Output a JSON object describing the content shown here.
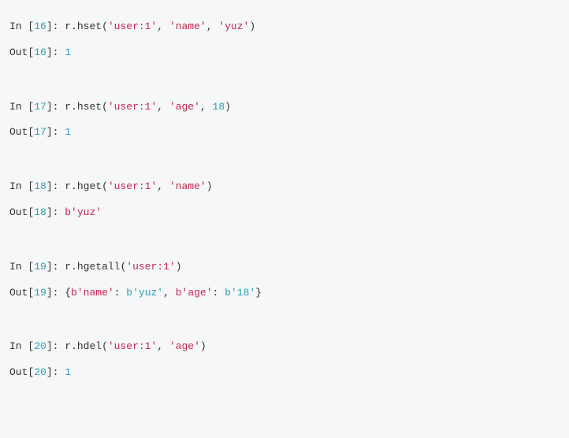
{
  "cells": [
    {
      "in_num": "16",
      "in_tokens": [
        {
          "t": "r",
          "c": "code"
        },
        {
          "t": ".",
          "c": "punct"
        },
        {
          "t": "hset(",
          "c": "code"
        },
        {
          "t": "'user:1'",
          "c": "str"
        },
        {
          "t": ", ",
          "c": "punct"
        },
        {
          "t": "'name'",
          "c": "str"
        },
        {
          "t": ", ",
          "c": "punct"
        },
        {
          "t": "'yuz'",
          "c": "str"
        },
        {
          "t": ")",
          "c": "code"
        }
      ],
      "out_num": "16",
      "out_tokens": [
        {
          "t": "1",
          "c": "int"
        }
      ]
    },
    {
      "in_num": "17",
      "in_tokens": [
        {
          "t": "r",
          "c": "code"
        },
        {
          "t": ".",
          "c": "punct"
        },
        {
          "t": "hset(",
          "c": "code"
        },
        {
          "t": "'user:1'",
          "c": "str"
        },
        {
          "t": ", ",
          "c": "punct"
        },
        {
          "t": "'age'",
          "c": "str"
        },
        {
          "t": ", ",
          "c": "punct"
        },
        {
          "t": "18",
          "c": "int"
        },
        {
          "t": ")",
          "c": "code"
        }
      ],
      "out_num": "17",
      "out_tokens": [
        {
          "t": "1",
          "c": "int"
        }
      ]
    },
    {
      "in_num": "18",
      "in_tokens": [
        {
          "t": "r",
          "c": "code"
        },
        {
          "t": ".",
          "c": "punct"
        },
        {
          "t": "hget(",
          "c": "code"
        },
        {
          "t": "'user:1'",
          "c": "str"
        },
        {
          "t": ", ",
          "c": "punct"
        },
        {
          "t": "'name'",
          "c": "str"
        },
        {
          "t": ")",
          "c": "code"
        }
      ],
      "out_num": "18",
      "out_tokens": [
        {
          "t": "b",
          "c": "bytes"
        },
        {
          "t": "'yuz'",
          "c": "bytes"
        }
      ]
    },
    {
      "in_num": "19",
      "in_tokens": [
        {
          "t": "r",
          "c": "code"
        },
        {
          "t": ".",
          "c": "punct"
        },
        {
          "t": "hgetall(",
          "c": "code"
        },
        {
          "t": "'user:1'",
          "c": "str"
        },
        {
          "t": ")",
          "c": "code"
        }
      ],
      "out_num": "19",
      "out_tokens": [
        {
          "t": "{",
          "c": "punct"
        },
        {
          "t": "b",
          "c": "bytes"
        },
        {
          "t": "'name'",
          "c": "bytes"
        },
        {
          "t": ": ",
          "c": "punct"
        },
        {
          "t": "b",
          "c": "bytes-val"
        },
        {
          "t": "'yuz'",
          "c": "bytes-val"
        },
        {
          "t": ", ",
          "c": "punct"
        },
        {
          "t": "b",
          "c": "bytes"
        },
        {
          "t": "'age'",
          "c": "bytes"
        },
        {
          "t": ": ",
          "c": "punct"
        },
        {
          "t": "b",
          "c": "bytes-val"
        },
        {
          "t": "'18'",
          "c": "bytes-val"
        },
        {
          "t": "}",
          "c": "punct"
        }
      ]
    },
    {
      "in_num": "20",
      "in_tokens": [
        {
          "t": "r",
          "c": "code"
        },
        {
          "t": ".",
          "c": "punct"
        },
        {
          "t": "hdel(",
          "c": "code"
        },
        {
          "t": "'user:1'",
          "c": "str"
        },
        {
          "t": ", ",
          "c": "punct"
        },
        {
          "t": "'age'",
          "c": "str"
        },
        {
          "t": ")",
          "c": "code"
        }
      ],
      "out_num": "20",
      "out_tokens": [
        {
          "t": "1",
          "c": "int"
        }
      ]
    }
  ],
  "labels": {
    "in_prefix": "In [",
    "in_suffix": "]: ",
    "out_prefix": "Out[",
    "out_suffix": "]: "
  }
}
